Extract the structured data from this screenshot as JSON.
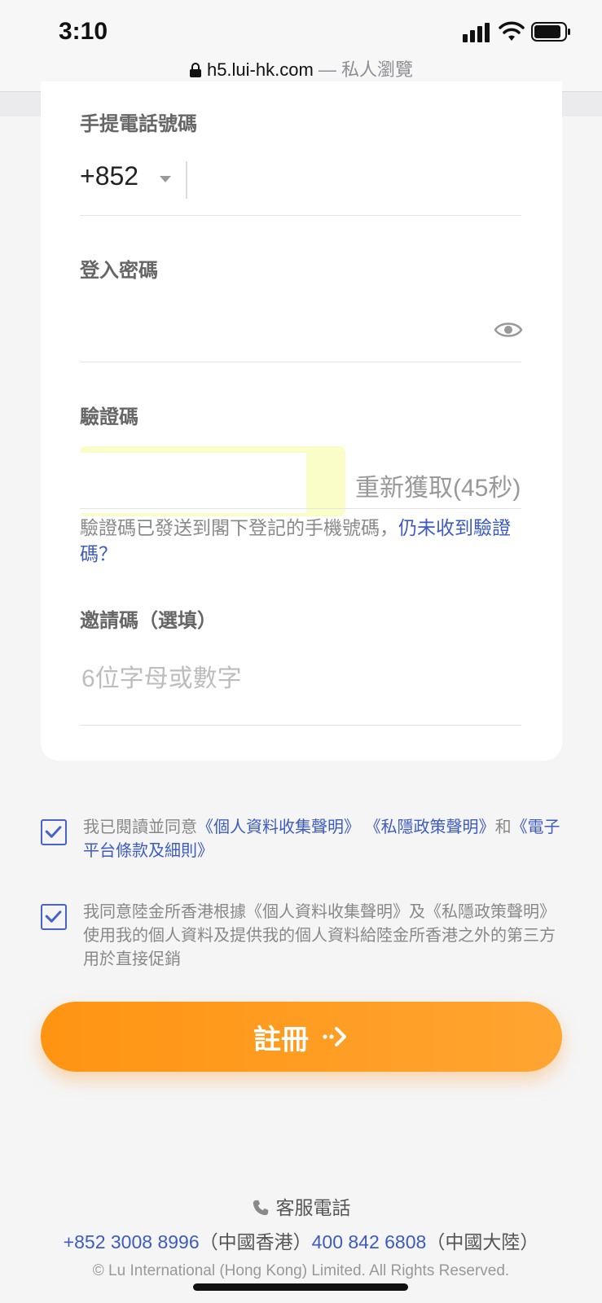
{
  "status_bar": {
    "time": "3:10",
    "icons": [
      "signal-icon",
      "wifi-icon",
      "battery-icon"
    ]
  },
  "browser": {
    "url": "h5.lui-hk.com",
    "private_label": " — 私人瀏覽"
  },
  "form": {
    "phone": {
      "label": "手提電話號碼",
      "country_code": "+852",
      "value": "",
      "placeholder": ""
    },
    "password": {
      "label": "登入密碼",
      "value": "",
      "placeholder": ""
    },
    "verification": {
      "label": "驗證碼",
      "value": "",
      "resend_label": "重新獲取(45秒)",
      "hint_text": "驗證碼已發送到閣下登記的手機號碼，",
      "hint_link": "仍未收到驗證碼？"
    },
    "invite": {
      "label": "邀請碼（選填）",
      "value": "",
      "placeholder": "6位字母或數字"
    }
  },
  "agreements": [
    {
      "checked": true,
      "prefix": "我已閱讀並同意",
      "link1": "《個人資料收集聲明》",
      "link2": "《私隱政策聲明》",
      "joiner": "和",
      "link3": "《電子平台條款及細則》"
    },
    {
      "checked": true,
      "text": "我同意陸金所香港根據《個人資料收集聲明》及《私隱政策聲明》使用我的個人資料及提供我的個人資料給陸金所香港之外的第三方用於直接促銷"
    }
  ],
  "submit_label": "註冊",
  "footer": {
    "cs_label": "客服電話",
    "hk_number": "+852 3008 8996",
    "hk_region": "（中國香港）",
    "cn_number": "400 842 6808",
    "cn_region": "（中國大陸）",
    "copyright": "© Lu International (Hong Kong) Limited. All Rights Reserved."
  },
  "colors": {
    "accent_orange": "#ff9412",
    "link_blue": "#3d5bc0",
    "autofill_yellow": "#fafdc8"
  }
}
